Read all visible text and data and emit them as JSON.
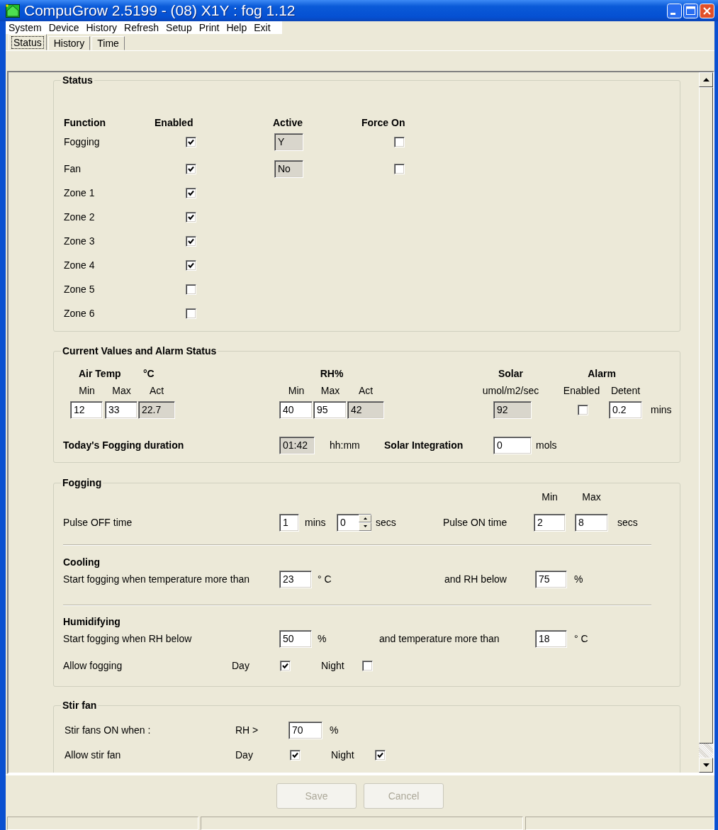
{
  "window": {
    "title": "CompuGrow 2.5199 - (08) X1Y : fog 1.12"
  },
  "menu": [
    {
      "label": "System"
    },
    {
      "label": "Device"
    },
    {
      "label": "History"
    },
    {
      "label": "Refresh"
    },
    {
      "label": "Setup"
    },
    {
      "label": "Print"
    },
    {
      "label": "Help"
    },
    {
      "label": "Exit"
    }
  ],
  "tabs": [
    {
      "label": "Status",
      "selected": true
    },
    {
      "label": "History",
      "selected": false
    },
    {
      "label": "Time",
      "selected": false
    }
  ],
  "status": {
    "title": "Status",
    "headers": [
      "Function",
      "Enabled",
      "Active",
      "Force On"
    ],
    "rows": [
      {
        "function": "Fogging",
        "enabled": true,
        "active": "Y",
        "force_on": false
      },
      {
        "function": "Fan",
        "enabled": true,
        "active": "No",
        "force_on": false
      },
      {
        "function": "Zone 1",
        "enabled": true
      },
      {
        "function": "Zone 2",
        "enabled": true
      },
      {
        "function": "Zone 3",
        "enabled": true
      },
      {
        "function": "Zone 4",
        "enabled": true
      },
      {
        "function": "Zone 5",
        "enabled": false
      },
      {
        "function": "Zone 6",
        "enabled": false
      }
    ]
  },
  "current_values": {
    "title": "Current Values and Alarm Status",
    "air_temp": {
      "title": "Air Temp",
      "unit": "°C",
      "labels": [
        "Min",
        "Max",
        "Act"
      ],
      "values": [
        "12",
        "33",
        "22.7"
      ]
    },
    "rh": {
      "title": "RH%",
      "labels": [
        "Min",
        "Max",
        "Act"
      ],
      "values": [
        "40",
        "95",
        "42"
      ]
    },
    "solar": {
      "title": "Solar",
      "unit": "umol/m2/sec",
      "value": "92"
    },
    "alarm": {
      "title": "Alarm",
      "enabled_label": "Enabled",
      "detent_label": "Detent",
      "enabled": false,
      "detent": "0.2",
      "unit": "mins"
    },
    "fogging_duration": {
      "label": "Today's Fogging duration",
      "value": "01:42",
      "unit": "hh:mm"
    },
    "solar_integration": {
      "label": "Solar Integration",
      "value": "0",
      "unit": "mols"
    }
  },
  "fogging": {
    "title": "Fogging",
    "pulse_off": {
      "label": "Pulse OFF time",
      "mins": "1",
      "mins_unit": "mins",
      "secs": "0",
      "secs_unit": "secs"
    },
    "pulse_on": {
      "label": "Pulse ON time",
      "min_label": "Min",
      "max_label": "Max",
      "min": "2",
      "max": "8",
      "unit": "secs"
    },
    "cooling": {
      "title": "Cooling",
      "label": "Start fogging when temperature more than",
      "value": "23",
      "unit": "° C",
      "label2": "and RH below",
      "value2": "75",
      "unit2": "%"
    },
    "humidifying": {
      "title": "Humidifying",
      "label": "Start fogging when RH below",
      "value": "50",
      "unit": "%",
      "label2": "and temperature more than",
      "value2": "18",
      "unit2": "° C"
    },
    "allow": {
      "label": "Allow fogging",
      "day_label": "Day",
      "day": true,
      "night_label": "Night",
      "night": false
    }
  },
  "stir_fan": {
    "title": "Stir fan",
    "condition": {
      "label": "Stir fans ON when :",
      "operator": "RH >",
      "value": "70",
      "unit": "%"
    },
    "allow": {
      "label": "Allow stir fan",
      "day_label": "Day",
      "day": true,
      "night_label": "Night",
      "night": true
    }
  },
  "buttons": [
    {
      "label": "Save",
      "disabled": true
    },
    {
      "label": "Cancel",
      "disabled": true
    }
  ]
}
